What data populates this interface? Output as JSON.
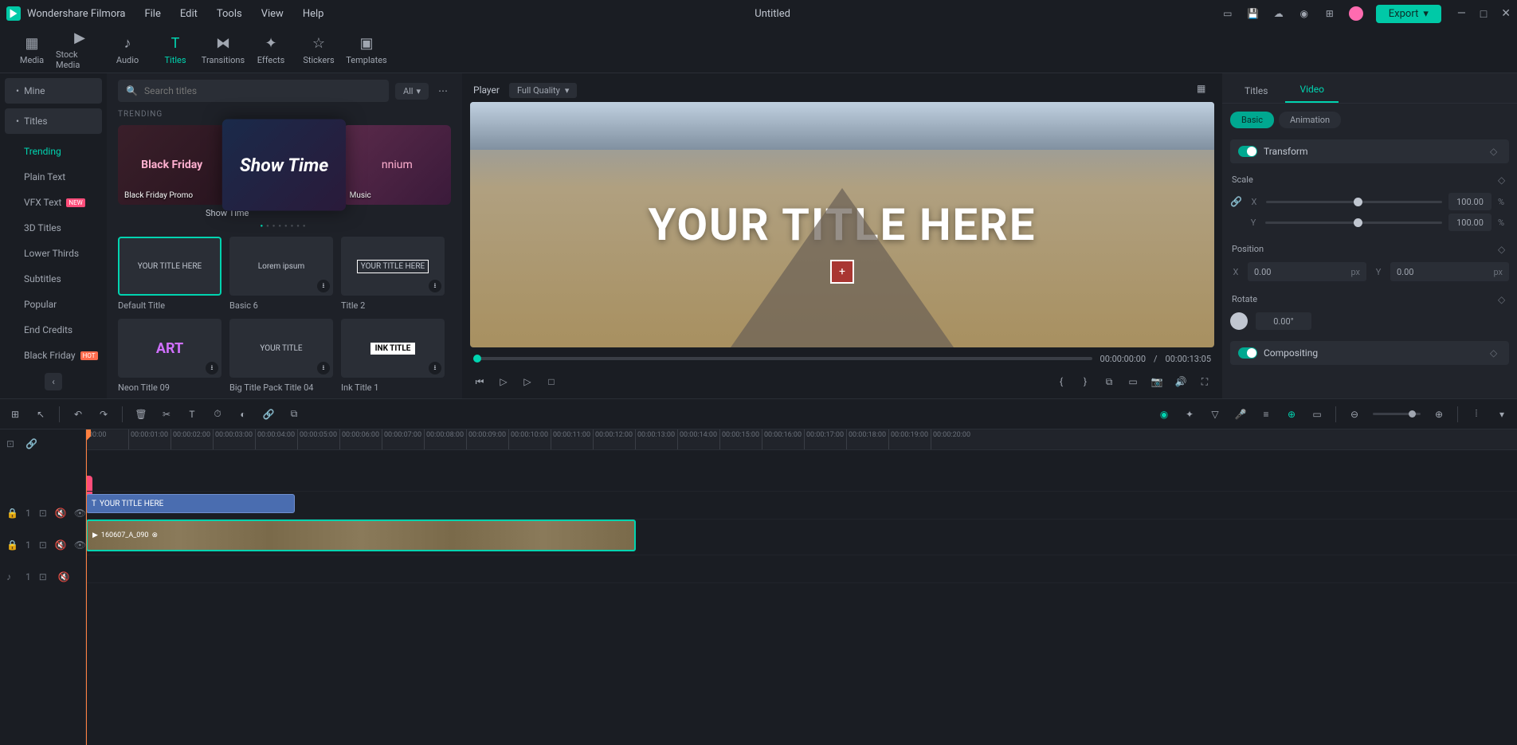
{
  "titlebar": {
    "app_name": "Wondershare Filmora",
    "menus": [
      "File",
      "Edit",
      "Tools",
      "View",
      "Help"
    ],
    "document_title": "Untitled",
    "export_label": "Export"
  },
  "topnav": [
    {
      "icon": "media",
      "label": "Media"
    },
    {
      "icon": "stock",
      "label": "Stock Media"
    },
    {
      "icon": "audio",
      "label": "Audio"
    },
    {
      "icon": "titles",
      "label": "Titles",
      "active": true
    },
    {
      "icon": "transitions",
      "label": "Transitions"
    },
    {
      "icon": "effects",
      "label": "Effects"
    },
    {
      "icon": "stickers",
      "label": "Stickers"
    },
    {
      "icon": "templates",
      "label": "Templates"
    }
  ],
  "sidebar": {
    "mine_label": "Mine",
    "titles_label": "Titles",
    "categories": [
      {
        "label": "Trending",
        "active": true
      },
      {
        "label": "Plain Text"
      },
      {
        "label": "VFX Text",
        "badge": "NEW"
      },
      {
        "label": "3D Titles"
      },
      {
        "label": "Lower Thirds"
      },
      {
        "label": "Subtitles"
      },
      {
        "label": "Popular"
      },
      {
        "label": "End Credits"
      },
      {
        "label": "Black Friday",
        "badge": "HOT"
      }
    ]
  },
  "browser": {
    "search_placeholder": "Search titles",
    "filter_label": "All",
    "section_label": "TRENDING",
    "carousel": [
      {
        "label": "Black Friday Promo",
        "art": "Black Friday"
      },
      {
        "label": "Show Time",
        "art": "Show Time"
      },
      {
        "label": "Music",
        "art": "nnium"
      }
    ],
    "carousel_below": "Show Time",
    "grid": [
      {
        "label": "Default Title",
        "thumb": "YOUR TITLE HERE",
        "selected": true
      },
      {
        "label": "Basic 6",
        "thumb": "Lorem ipsum"
      },
      {
        "label": "Title 2",
        "thumb": "YOUR TITLE HERE"
      },
      {
        "label": "Neon Title 09",
        "thumb": "ART"
      },
      {
        "label": "Big Title Pack Title 04",
        "thumb": "YOUR TITLE"
      },
      {
        "label": "Ink Title 1",
        "thumb": "INK TITLE"
      }
    ]
  },
  "player": {
    "label": "Player",
    "quality": "Full Quality",
    "preview_title": "YOUR TITLE HERE",
    "time_current": "00:00:00:00",
    "time_sep": "/",
    "time_total": "00:00:13:05"
  },
  "inspector": {
    "tabs": [
      "Titles",
      "Video"
    ],
    "active_tab": "Video",
    "subtabs": [
      "Basic",
      "Animation"
    ],
    "active_subtab": "Basic",
    "transform_label": "Transform",
    "scale_label": "Scale",
    "scale_x": "100.00",
    "scale_y": "100.00",
    "position_label": "Position",
    "pos_x": "0.00",
    "pos_y": "0.00",
    "pos_unit_x": "px",
    "pos_unit_y": "px",
    "rotate_label": "Rotate",
    "rotate_val": "0.00°",
    "compositing_label": "Compositing",
    "axis_x": "X",
    "axis_y": "Y",
    "pct": "%"
  },
  "timeline": {
    "ruler": [
      "00:00",
      "00:00:01:00",
      "00:00:02:00",
      "00:00:03:00",
      "00:00:04:00",
      "00:00:05:00",
      "00:00:06:00",
      "00:00:07:00",
      "00:00:08:00",
      "00:00:09:00",
      "00:00:10:00",
      "00:00:11:00",
      "00:00:12:00",
      "00:00:13:00",
      "00:00:14:00",
      "00:00:15:00",
      "00:00:16:00",
      "00:00:17:00",
      "00:00:18:00",
      "00:00:19:00",
      "00:00:20:00"
    ],
    "title_clip_label": "YOUR TITLE HERE",
    "video_clip_label": "160607_A_090"
  }
}
